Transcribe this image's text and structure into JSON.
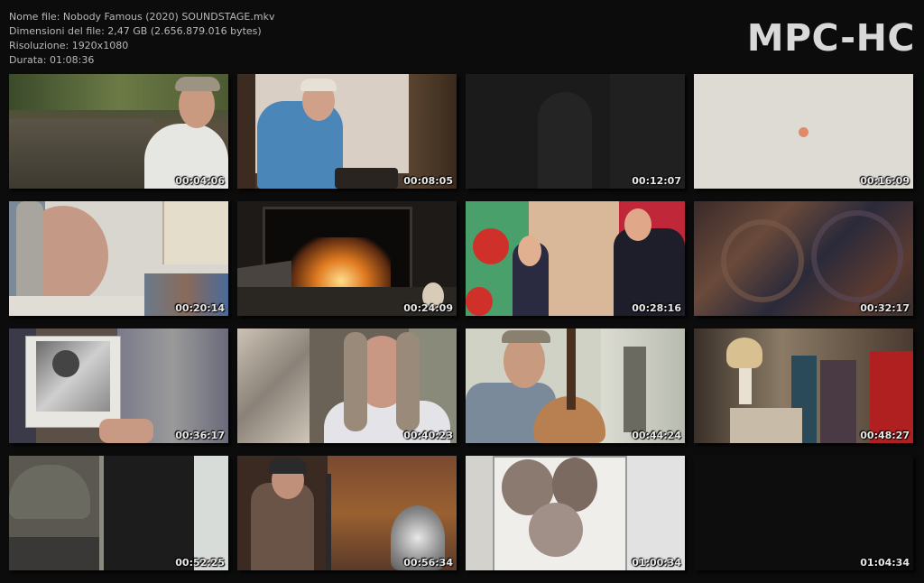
{
  "file_info": {
    "name": "Nome file: Nobody Famous (2020) SOUNDSTAGE.mkv",
    "size": "Dimensioni del file: 2,47 GB (2.656.879.016 bytes)",
    "resolution": "Risoluzione: 1920x1080",
    "duration": "Durata: 01:08:36"
  },
  "logo": "MPC-HC",
  "thumbnails": [
    {
      "time": "00:04:06"
    },
    {
      "time": "00:08:05"
    },
    {
      "time": "00:12:07"
    },
    {
      "time": "00:16:09"
    },
    {
      "time": "00:20:14"
    },
    {
      "time": "00:24:09"
    },
    {
      "time": "00:28:16"
    },
    {
      "time": "00:32:17"
    },
    {
      "time": "00:36:17"
    },
    {
      "time": "00:40:23"
    },
    {
      "time": "00:44:24"
    },
    {
      "time": "00:48:27"
    },
    {
      "time": "00:52:25"
    },
    {
      "time": "00:56:34"
    },
    {
      "time": "01:00:34"
    },
    {
      "time": "01:04:34"
    }
  ]
}
